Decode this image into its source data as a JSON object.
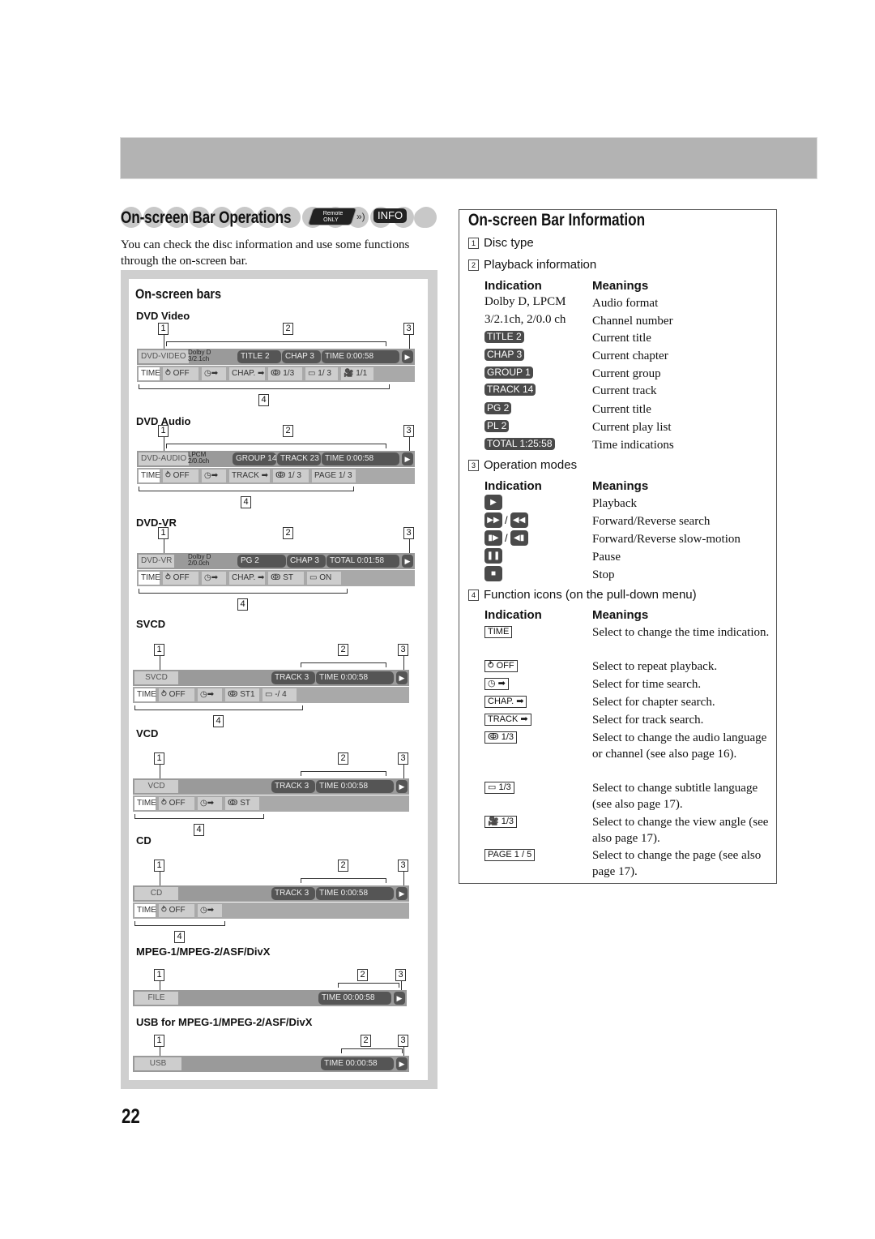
{
  "page": {
    "number": "22"
  },
  "left": {
    "title": "On-screen Bar Operations",
    "remote_badge": {
      "line1": "Remote",
      "line2": "ONLY"
    },
    "info_badge": "INFO",
    "intro": "You can check the disc information and use some functions through the on-screen bar.",
    "panel_title": "On-screen bars",
    "sections": [
      {
        "title": "DVD Video",
        "disc": "DVD-VIDEO",
        "fmt1": "Dolby D",
        "fmt2": "3/2.1ch",
        "pills": [
          "TITLE  2",
          "CHAP  3",
          "TIME    0:00:58"
        ],
        "functions": [
          "TIME",
          "⥁ OFF",
          "◷➡",
          "CHAP. ➡",
          "ↂ 1/3",
          "▭  1/ 3",
          "🎥 1/1"
        ]
      },
      {
        "title": "DVD Audio",
        "disc": "DVD-AUDIO",
        "fmt1": "LPCM",
        "fmt2": "2/0.0ch",
        "pills": [
          "GROUP 14",
          "TRACK 23",
          "TIME    0:00:58"
        ],
        "functions": [
          "TIME",
          "⥁ OFF",
          "◷➡",
          "TRACK ➡",
          "ↂ 1/ 3",
          "PAGE 1/ 3"
        ]
      },
      {
        "title": "DVD-VR",
        "disc": "DVD-VR",
        "fmt1": "Dolby D",
        "fmt2": "2/0.0ch",
        "pills": [
          "PG      2",
          "CHAP  3",
          "TOTAL  0:01:58"
        ],
        "functions": [
          "TIME",
          "⥁ OFF",
          "◷➡",
          "CHAP. ➡",
          "ↂ ST",
          "▭  ON"
        ]
      },
      {
        "title": "SVCD",
        "disc": "SVCD",
        "pills": [
          "TRACK  3",
          "TIME    0:00:58"
        ],
        "functions": [
          "TIME",
          "⥁ OFF",
          "◷➡",
          "ↂ ST1",
          "▭ -/ 4"
        ]
      },
      {
        "title": "VCD",
        "disc": "VCD",
        "pills": [
          "TRACK  3",
          "TIME    0:00:58"
        ],
        "functions": [
          "TIME",
          "⥁ OFF",
          "◷➡",
          "ↂ ST"
        ]
      },
      {
        "title": "CD",
        "disc": "CD",
        "pills": [
          "TRACK  3",
          "TIME    0:00:58"
        ],
        "functions": [
          "TIME",
          "⥁ OFF",
          "◷➡"
        ]
      },
      {
        "title": "MPEG-1/MPEG-2/ASF/DivX",
        "disc": "FILE",
        "pills": [
          "TIME  00:00:58"
        ]
      },
      {
        "title": "USB for MPEG-1/MPEG-2/ASF/DivX",
        "disc": "USB",
        "pills": [
          "TIME  00:00:58"
        ]
      }
    ],
    "markers": [
      "1",
      "2",
      "3",
      "4"
    ],
    "play_glyph": "▶"
  },
  "right": {
    "title": "On-screen Bar Information",
    "items": [
      {
        "num": "1",
        "label": "Disc type"
      },
      {
        "num": "2",
        "label": "Playback information"
      },
      {
        "num": "3",
        "label": "Operation modes"
      },
      {
        "num": "4",
        "label": "Function icons (on the pull-down menu)"
      }
    ],
    "col_indication": "Indication",
    "col_meanings": "Meanings",
    "playback_rows": [
      {
        "ind": "Dolby D, LPCM",
        "mean": "Audio format",
        "pill": false
      },
      {
        "ind": "3/2.1ch, 2/0.0 ch",
        "mean": "Channel number",
        "pill": false
      },
      {
        "ind": "TITLE  2",
        "mean": "Current title",
        "pill": true
      },
      {
        "ind": "CHAP  3",
        "mean": "Current chapter",
        "pill": true
      },
      {
        "ind": "GROUP 1",
        "mean": "Current group",
        "pill": true
      },
      {
        "ind": "TRACK 14",
        "mean": "Current track",
        "pill": true
      },
      {
        "ind": "PG      2",
        "mean": "Current title",
        "pill": true
      },
      {
        "ind": "PL      2",
        "mean": "Current play list",
        "pill": true
      },
      {
        "ind": "TOTAL 1:25:58",
        "mean": "Time indications",
        "pill": true
      }
    ],
    "op_rows": [
      {
        "icons": [
          "▶"
        ],
        "mean": "Playback"
      },
      {
        "icons": [
          "▶▶",
          "◀◀"
        ],
        "mean": "Forward/Reverse search"
      },
      {
        "icons": [
          "▮▶",
          "◀▮"
        ],
        "mean": "Forward/Reverse slow-motion"
      },
      {
        "icons": [
          "❚❚"
        ],
        "mean": "Pause"
      },
      {
        "icons": [
          "■"
        ],
        "mean": "Stop"
      }
    ],
    "fn_rows": [
      {
        "ind": "TIME",
        "mean": "Select to change the time indication."
      },
      {
        "ind": "⥁ OFF",
        "mean": "Select to repeat playback."
      },
      {
        "ind": "◷ ➡",
        "mean": "Select for time search."
      },
      {
        "ind": "CHAP. ➡",
        "mean": "Select for chapter search."
      },
      {
        "ind": "TRACK ➡",
        "mean": "Select for track search."
      },
      {
        "ind": "ↂ  1/3",
        "mean": "Select to change the audio language or channel (see also page 16)."
      },
      {
        "ind": "▭   1/3",
        "mean": "Select to change subtitle language (see also page 17)."
      },
      {
        "ind": "🎥 1/3",
        "mean": "Select to change the view angle (see also page 17)."
      },
      {
        "ind": "PAGE  1 / 5",
        "mean": "Select to change the page (see also page 17)."
      }
    ]
  }
}
